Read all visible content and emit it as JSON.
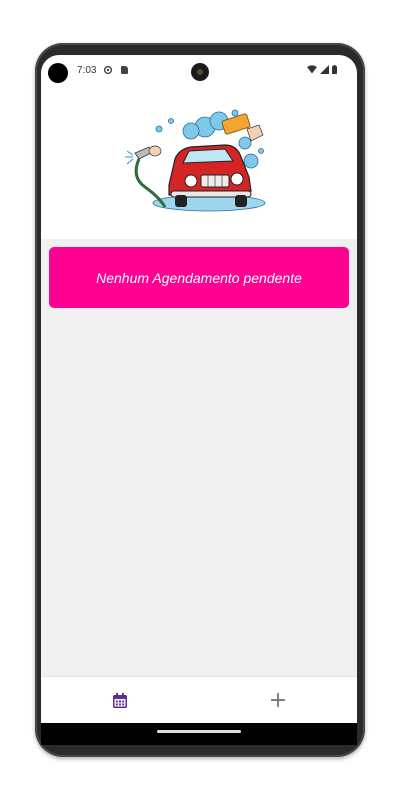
{
  "status_bar": {
    "time": "7:03",
    "icons": [
      "settings-gear-icon",
      "sd-card-icon",
      "wifi-icon",
      "signal-icon",
      "battery-icon"
    ]
  },
  "header": {
    "logo": "car-wash-illustration"
  },
  "main": {
    "empty_message": "Nenhum Agendamento pendente",
    "banner_color": "#ff0090"
  },
  "bottom_nav": {
    "items": [
      {
        "icon": "calendar-icon",
        "active": true,
        "color": "#5a2d91"
      },
      {
        "icon": "plus-icon",
        "glyph": "+",
        "active": false,
        "color": "#777777"
      }
    ]
  }
}
